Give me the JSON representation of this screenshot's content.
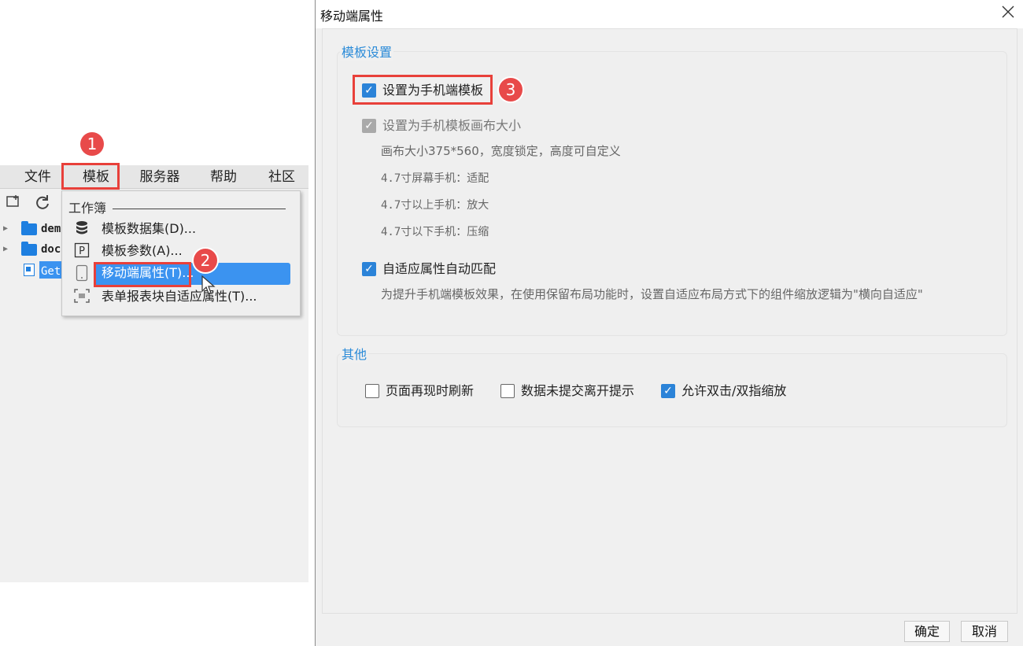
{
  "menubar": {
    "items": [
      "文件",
      "模板",
      "服务器",
      "帮助",
      "社区"
    ]
  },
  "tree": {
    "rows": [
      {
        "label": "dem"
      },
      {
        "label": "doc"
      },
      {
        "label": "Get"
      }
    ]
  },
  "dropdown": {
    "header": "工作簿",
    "items": [
      {
        "label": "模板数据集(D)...",
        "icon": "database-icon"
      },
      {
        "label": "模板参数(A)...",
        "icon": "parameter-icon"
      },
      {
        "label": "移动端属性(T)...",
        "icon": "tablet-icon"
      },
      {
        "label": "表单报表块自适应属性(T)...",
        "icon": "adaptive-icon"
      }
    ]
  },
  "badges": {
    "one": "1",
    "two": "2",
    "three": "3"
  },
  "dialog": {
    "title": "移动端属性",
    "template_group": {
      "title": "模板设置",
      "set_mobile_template": "设置为手机端模板",
      "set_canvas_size": "设置为手机模板画布大小",
      "canvas_note": "画布大小375*560，宽度锁定，高度可自定义",
      "size_47": "4.7寸屏幕手机：适配",
      "size_above": "4.7寸以上手机：放大",
      "size_below": "4.7寸以下手机：压缩",
      "auto_match": "自适应属性自动匹配",
      "auto_match_note": "为提升手机端模板效果，在使用保留布局功能时，设置自适应布局方式下的组件缩放逻辑为\"横向自适应\""
    },
    "other_group": {
      "title": "其他",
      "refresh_on_show": "页面再现时刷新",
      "unsubmitted_prompt": "数据未提交离开提示",
      "allow_zoom": "允许双击/双指缩放"
    },
    "ok": "确定",
    "cancel": "取消"
  },
  "colors": {
    "accent": "#2b83d8",
    "highlight": "#3b93f0",
    "annotation": "#e84a4a"
  }
}
